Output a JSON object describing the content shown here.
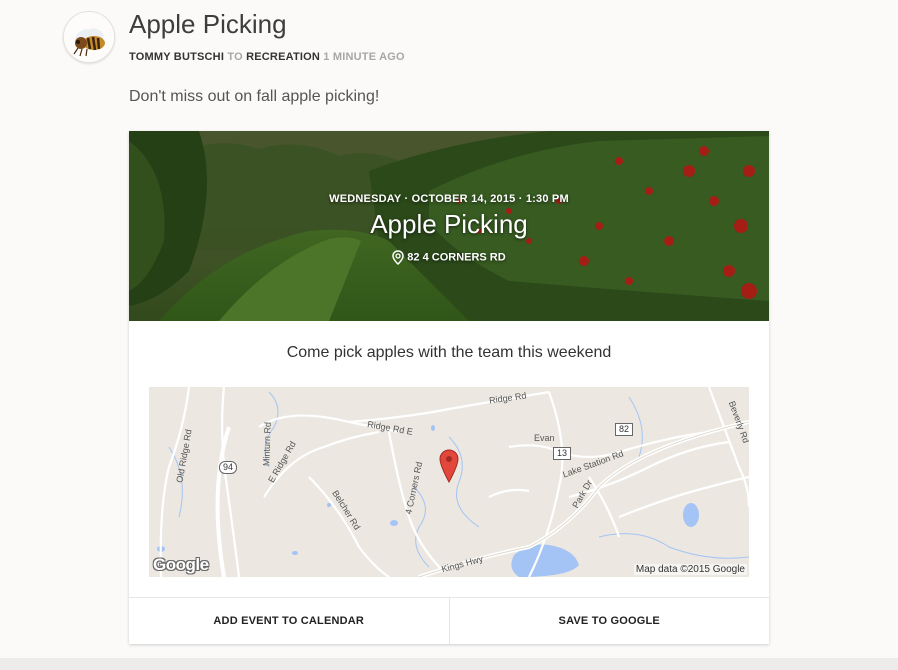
{
  "post": {
    "title": "Apple Picking",
    "author": "TOMMY BUTSCHI",
    "to_word": "TO",
    "group": "RECREATION",
    "time": "1 MINUTE AGO",
    "body": "Don't miss out on fall apple picking!",
    "avatar_icon": "bee-icon"
  },
  "event": {
    "datetime": "WEDNESDAY · OCTOBER 14, 2015 · 1:30 PM",
    "title": "Apple Picking",
    "location": "82 4 CORNERS RD",
    "description": "Come pick apples with the team this weekend"
  },
  "map": {
    "roads": {
      "ridge_rd": "Ridge Rd",
      "ridge_rd_e": "Ridge Rd E",
      "old_ridge_rd": "Old Ridge Rd",
      "minturn_rd": "Minturn Rd",
      "e_ridge_rd": "E Ridge Rd",
      "belcher_rd": "Belcher Rd",
      "four_corners_rd": "4 Corners Rd",
      "evan": "Evan",
      "lake_station_rd": "Lake Station Rd",
      "park_dr": "Park Dr",
      "beverly_rd": "Beverly Rd",
      "kings_hwy": "Kings Hwy"
    },
    "shields": {
      "r94": "94",
      "r13": "13",
      "r82": "82"
    },
    "copyright": "Map data ©2015 Google",
    "logo": "Google",
    "colors": {
      "land": "#ece8e1",
      "water": "#a3c4f5",
      "road": "#ffffff",
      "pin": "#e2473c"
    }
  },
  "actions": {
    "add_calendar": "ADD EVENT TO CALENDAR",
    "save_google": "SAVE TO GOOGLE"
  }
}
